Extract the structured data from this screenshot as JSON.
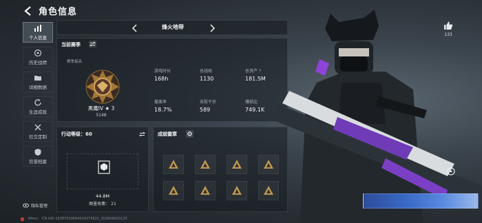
{
  "header": {
    "title": "角色信息"
  },
  "nav": [
    {
      "label": "个人信息",
      "icon": "bar-chart-icon",
      "active": true
    },
    {
      "label": "历史战绩",
      "icon": "target-icon",
      "active": false
    },
    {
      "label": "详细数据",
      "icon": "folder-icon",
      "active": false
    },
    {
      "label": "生涯成就",
      "icon": "refresh-icon",
      "active": false
    },
    {
      "label": "社交定制",
      "icon": "tools-icon",
      "active": false
    },
    {
      "label": "信誉档案",
      "icon": "shield-icon",
      "active": false
    }
  ],
  "privacy": {
    "label": "隐私管理"
  },
  "map": {
    "name": "烽火地带"
  },
  "season": {
    "heading": "当前赛季",
    "best_label": "赛季最高",
    "rank_name": "黑鹰IV ★ 3",
    "rank_points": "5148",
    "stats": [
      {
        "label": "游戏时长",
        "value": "168h"
      },
      {
        "label": "总战局",
        "value": "1130"
      },
      {
        "label": "总资产 ?",
        "value": "181.5M"
      },
      {
        "label": "撤离率",
        "value": "18.7%"
      },
      {
        "label": "击败干员",
        "value": "589"
      },
      {
        "label": "赚损比",
        "value": "749.1K"
      }
    ]
  },
  "level": {
    "label": "行动等级：60",
    "collect_amount": "44.8M",
    "collect_label": "图鉴收集： 21"
  },
  "badges": {
    "heading": "成就徽章",
    "count": 8
  },
  "like": {
    "count": "133"
  },
  "footer": {
    "ping": "84ms",
    "uid": "CN UID:18387059694534373622_202609020125"
  },
  "colors": {
    "accent": "#f2f4f5",
    "badge_gold": "#c9a35a",
    "alert": "#c0392b"
  }
}
